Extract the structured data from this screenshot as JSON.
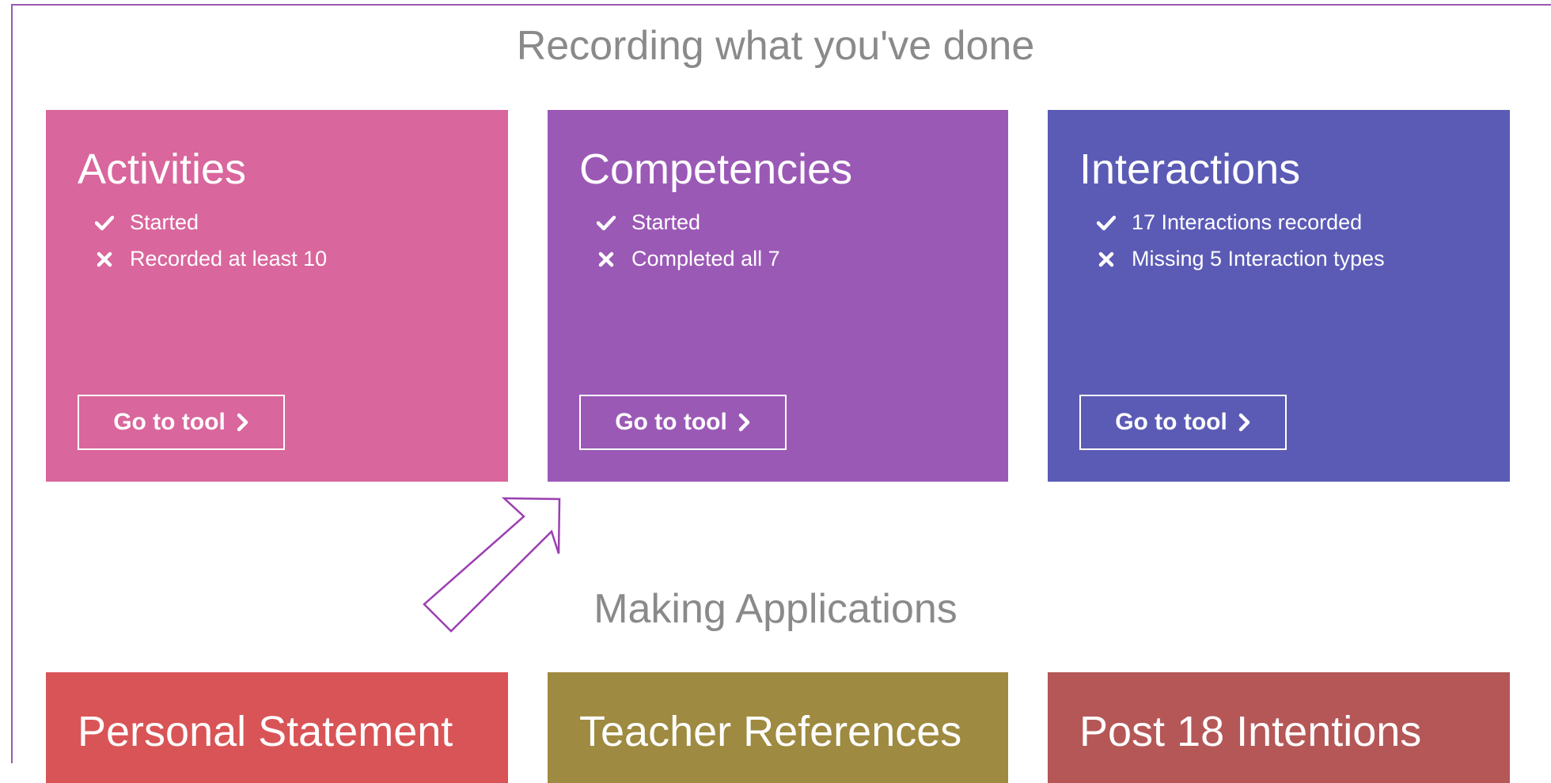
{
  "recording": {
    "title": "Recording what you've done",
    "cards": [
      {
        "title": "Activities",
        "color": "#d9669c",
        "items": [
          {
            "status": "check-icon",
            "text": "Started"
          },
          {
            "status": "cross-icon",
            "text": "Recorded at least 10"
          }
        ],
        "button": "Go to tool"
      },
      {
        "title": "Competencies",
        "color": "#9b59b6",
        "items": [
          {
            "status": "check-icon",
            "text": "Started"
          },
          {
            "status": "cross-icon",
            "text": "Completed all 7"
          }
        ],
        "button": "Go to tool"
      },
      {
        "title": "Interactions",
        "color": "#5b5bb6",
        "items": [
          {
            "status": "check-icon",
            "text": "17 Interactions recorded"
          },
          {
            "status": "cross-icon",
            "text": "Missing 5 Interaction types"
          }
        ],
        "button": "Go to tool"
      }
    ]
  },
  "applications": {
    "title": "Making Applications",
    "cards": [
      {
        "title": "Personal Statement",
        "color": "#d95456"
      },
      {
        "title": "Teacher References",
        "color": "#9e8a40"
      },
      {
        "title": "Post 18 Intentions",
        "color": "#b55757"
      }
    ]
  },
  "annotation": {
    "icon": "arrow-icon",
    "color": "#9b3fb0"
  }
}
